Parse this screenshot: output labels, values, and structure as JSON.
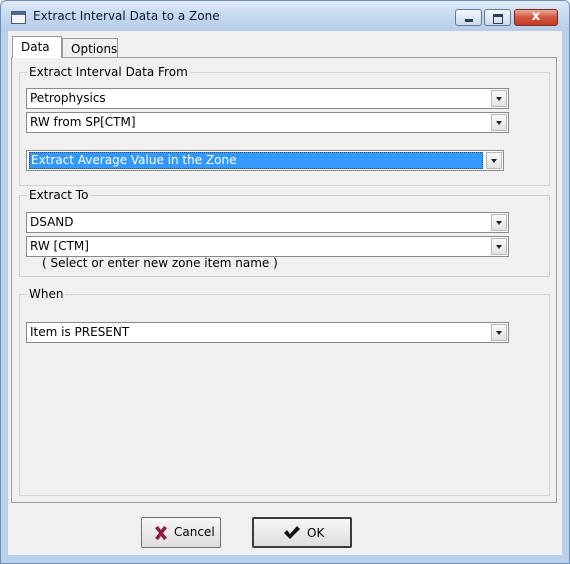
{
  "window": {
    "title": "Extract Interval Data to a Zone",
    "close_glyph": "x"
  },
  "tabs": [
    {
      "label": "Data",
      "active": true
    },
    {
      "label": "Options",
      "active": false
    }
  ],
  "extract_from": {
    "legend": "Extract Interval Data From",
    "source": "Petrophysics",
    "curve": "RW from SP[CTM]",
    "method": "Extract Average Value in the Zone"
  },
  "extract_to": {
    "legend": "Extract To",
    "zone": "DSAND",
    "item": "RW  [CTM]",
    "hint": "( Select or enter new zone item name )"
  },
  "when": {
    "legend": "When",
    "condition": "Item is PRESENT"
  },
  "buttons": {
    "cancel_label": "Cancel",
    "ok_label": "OK"
  },
  "colors": {
    "selection": "#3399ff",
    "cancel_icon": "#8b1f3a",
    "ok_icon": "#111111"
  },
  "icons": {
    "cancel": "x-icon",
    "ok": "checkmark-icon"
  }
}
